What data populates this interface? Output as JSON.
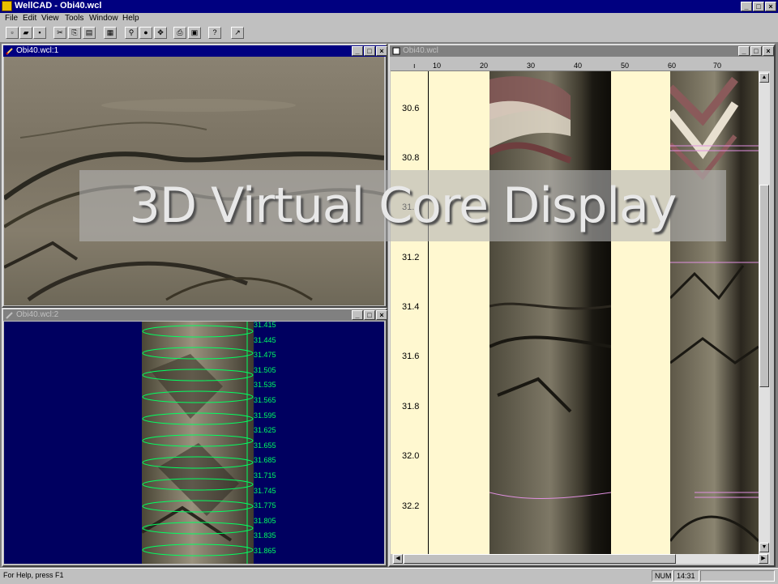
{
  "app": {
    "title": "WellCAD - Obi40.wcl"
  },
  "menu": [
    "File",
    "Edit",
    "View",
    "Tools",
    "Window",
    "Help"
  ],
  "windows": {
    "image": {
      "title": "Obi40.wcl:1"
    },
    "virtual_core": {
      "title": "Obi40.wcl:2"
    },
    "log": {
      "title": "Obi40.wcl"
    }
  },
  "ruler": {
    "ticks": [
      "10",
      "20",
      "30",
      "40",
      "50",
      "60",
      "70"
    ]
  },
  "log_depths": [
    "30.6",
    "30.8",
    "31.0",
    "31.2",
    "31.4",
    "31.6",
    "31.8",
    "32.0",
    "32.2"
  ],
  "core_depths": [
    "31.415",
    "31.445",
    "31.475",
    "31.505",
    "31.535",
    "31.565",
    "31.595",
    "31.625",
    "31.655",
    "31.685",
    "31.715",
    "31.745",
    "31.775",
    "31.805",
    "31.835",
    "31.865"
  ],
  "status": {
    "help": "For Help, press F1",
    "num": "NUM",
    "time": "14:31"
  },
  "overlay": {
    "text": "3D Virtual Core Display"
  },
  "colors": {
    "titlebar": "#000080",
    "core_lines": "#00ff60",
    "log_background": "#fff8d0"
  }
}
